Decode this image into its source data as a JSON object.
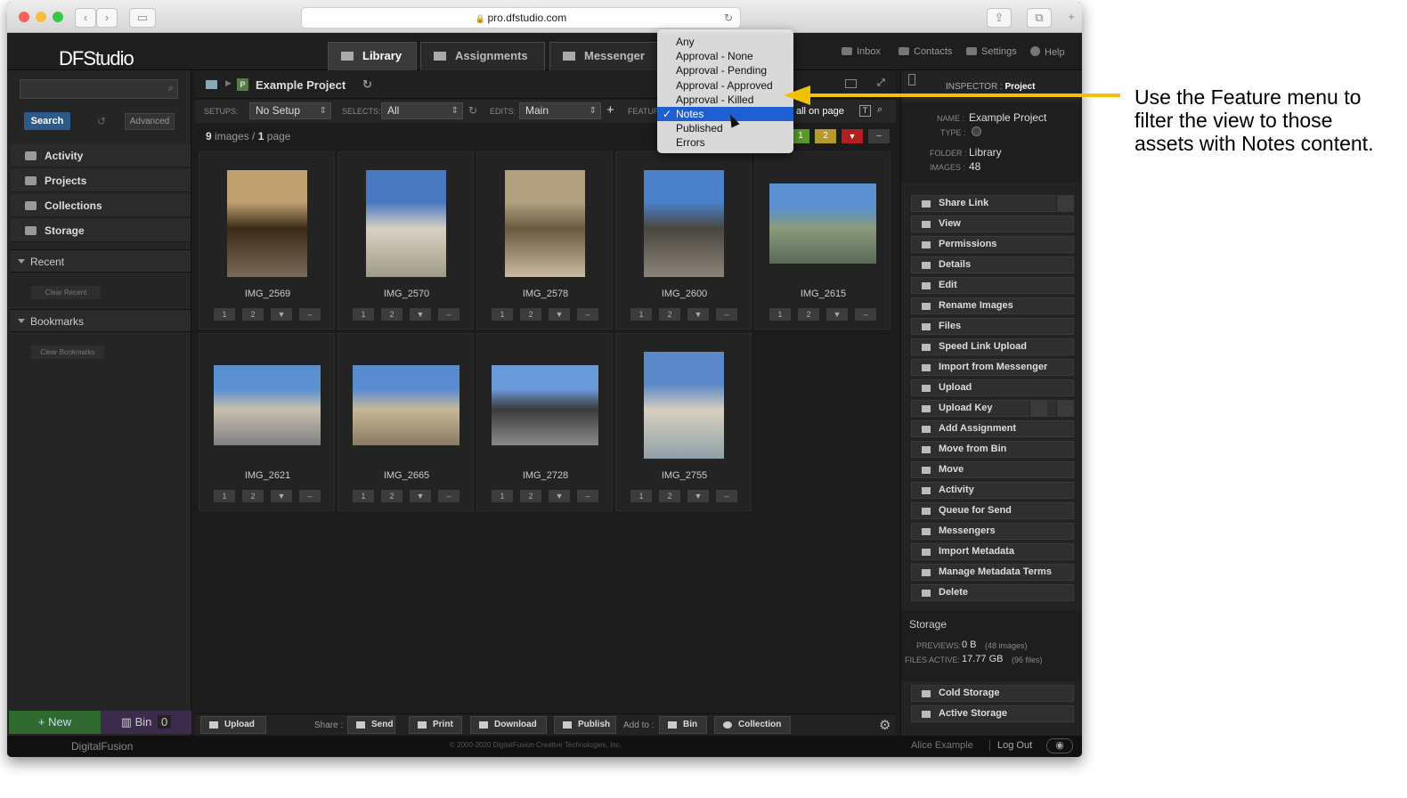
{
  "browser": {
    "url": "pro.dfstudio.com"
  },
  "app": {
    "logo": "DFStudio",
    "tabs": [
      "Library",
      "Assignments",
      "Messenger"
    ],
    "nav": [
      "Inbox",
      "Contacts",
      "Settings",
      "Help"
    ]
  },
  "sidebar": {
    "search_button": "Search",
    "advanced": "Advanced",
    "items": [
      "Activity",
      "Projects",
      "Collections",
      "Storage"
    ],
    "recent": "Recent",
    "clear_recent": "Clear Recent",
    "bookmarks": "Bookmarks",
    "clear_bookmarks": "Clear Bookmarks",
    "new": "+ New",
    "bin": "Bin",
    "bin_count": "0"
  },
  "main": {
    "project": "Example Project",
    "setups_label": "SETUPS:",
    "setup": "No Setup",
    "selects_label": "SELECTS:",
    "select": "All",
    "edits_label": "EDITS:",
    "edit": "Main",
    "feature_label": "FEATUR",
    "all_on_page": "all on page",
    "count_images": "9",
    "images_word": "images",
    "count_pages": "1",
    "page_word": "page",
    "ratings": [
      "1",
      "2"
    ],
    "images": [
      {
        "name": "IMG_2569",
        "colors": [
          "#c0a070",
          "#3a2a18",
          "#7a6a5a"
        ],
        "orient": "portrait"
      },
      {
        "name": "IMG_2570",
        "colors": [
          "#4a78c0",
          "#d8d2c4",
          "#a09a8a"
        ],
        "orient": "portrait"
      },
      {
        "name": "IMG_2578",
        "colors": [
          "#b0a080",
          "#6a5a40",
          "#cabba0"
        ],
        "orient": "portrait"
      },
      {
        "name": "IMG_2600",
        "colors": [
          "#4a80c8",
          "#4a4640",
          "#8a8478"
        ],
        "orient": "portrait"
      },
      {
        "name": "IMG_2615",
        "colors": [
          "#5a90d0",
          "#8a9a7a",
          "#5a6a5a"
        ],
        "orient": "landscape"
      },
      {
        "name": "IMG_2621",
        "colors": [
          "#5a90d0",
          "#c8c0b0",
          "#808080"
        ],
        "orient": "landscape"
      },
      {
        "name": "IMG_2665",
        "colors": [
          "#5a8ad0",
          "#c8b89a",
          "#8a7a60"
        ],
        "orient": "landscape"
      },
      {
        "name": "IMG_2728",
        "colors": [
          "#6a9ad8",
          "#3a3a3a",
          "#8a8a8a"
        ],
        "orient": "landscape"
      },
      {
        "name": "IMG_2755",
        "colors": [
          "#5a88c8",
          "#d8d0c0",
          "#90a0a8"
        ],
        "orient": "portrait"
      }
    ],
    "bottom": {
      "upload": "Upload",
      "share_label": "Share :",
      "send": "Send",
      "print": "Print",
      "download": "Download",
      "publish": "Publish",
      "addto_label": "Add to :",
      "bin": "Bin",
      "collection": "Collection"
    }
  },
  "feature_menu": {
    "items": [
      "Any",
      "Approval - None",
      "Approval - Pending",
      "Approval - Approved",
      "Approval - Killed",
      "Notes",
      "Published",
      "Errors"
    ],
    "selected": "Notes"
  },
  "inspector": {
    "title_label": "INSPECTOR :",
    "title": "Project",
    "name_label": "NAME :",
    "name": "Example Project",
    "type_label": "TYPE :",
    "folder_label": "FOLDER :",
    "folder": "Library",
    "images_label": "IMAGES :",
    "images": "48",
    "actions": [
      "Share Link",
      "View",
      "Permissions",
      "Details",
      "Edit",
      "Rename Images",
      "Files",
      "Speed Link Upload",
      "Import from Messenger",
      "Upload",
      "Upload Key",
      "Add Assignment",
      "Move from Bin",
      "Move",
      "Activity",
      "Queue for Send",
      "Messengers",
      "Import Metadata",
      "Manage Metadata Terms",
      "Delete"
    ],
    "storage_title": "Storage",
    "previews_label": "PREVIEWS:",
    "previews": "0 B",
    "previews_note": "(48 images)",
    "files_label": "FILES ACTIVE:",
    "files": "17.77 GB",
    "files_note": "(96 files)",
    "cold": "Cold Storage",
    "active": "Active Storage"
  },
  "footer": {
    "brand": "DigitalFusion",
    "copyright": "© 2000-2020 DigitalFusion Creative Technologies, Inc.",
    "user": "Alice Example",
    "logout": "Log Out"
  },
  "annotation": "Use the Feature menu to filter the view to those assets with Notes content.",
  "colors": {
    "accent_select": "#1d5fd0",
    "arrow": "#f2c200",
    "new_green": "#2f6a30"
  }
}
